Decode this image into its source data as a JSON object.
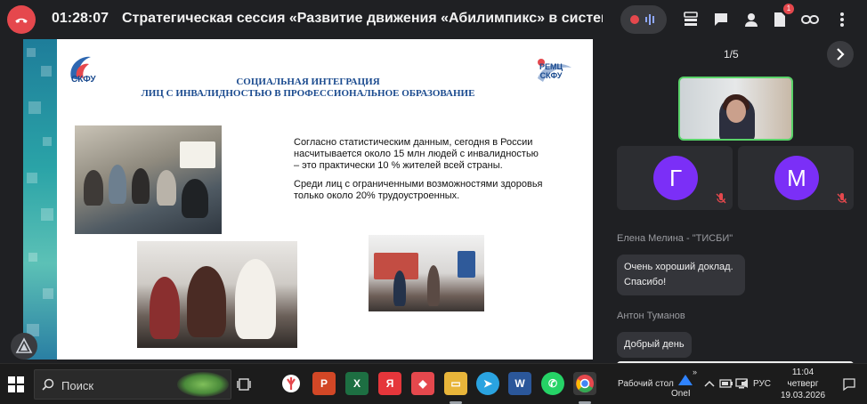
{
  "header": {
    "timer": "01:28:07",
    "title": "Стратегическая сессия «Развитие движения «Абилимпикс» в системе вы",
    "badge_count": "1"
  },
  "slide": {
    "logo_left": "СКФУ",
    "logo_right_line1": "РЕМЦ",
    "logo_right_line2": "СКФУ",
    "title_line1": "СОЦИАЛЬНАЯ ИНТЕГРАЦИЯ",
    "title_line2": "ЛИЦ С ИНВАЛИДНОСТЬЮ В ПРОФЕССИОНАЛЬНОЕ ОБРАЗОВАНИЕ",
    "paragraph1": "Согласно статистическим данным, сегодня в России насчитывается около 15 млн людей с инвалидностью – это практически 10 % жителей всей страны.",
    "paragraph2": "Среди лиц с ограниченными возможностями здоровья только около 20% трудоустроенных."
  },
  "panel": {
    "page_counter": "1/5",
    "tiles": [
      {
        "initial": "Г",
        "color": "#7b2ff7"
      },
      {
        "initial": "М",
        "color": "#7b2ff7"
      }
    ],
    "chat": [
      {
        "author": "Елена Мелина - \"ТИСБИ\"",
        "text_line1": "Очень хороший доклад.",
        "text_line2": "Спасибо!"
      },
      {
        "author": "Антон Туманов",
        "text_line1": "Добрый день"
      }
    ]
  },
  "taskbar": {
    "search_placeholder": "Поиск",
    "desktop_label": "Рабочий стол",
    "onedrive_label": "OneI",
    "language": "РУС",
    "time": "11:04",
    "weekday": "четверг",
    "date": "19.03.2026"
  },
  "colors": {
    "end_call": "#e5484d",
    "speaker_border": "#5ad36a",
    "avatar": "#7b2ff7"
  }
}
